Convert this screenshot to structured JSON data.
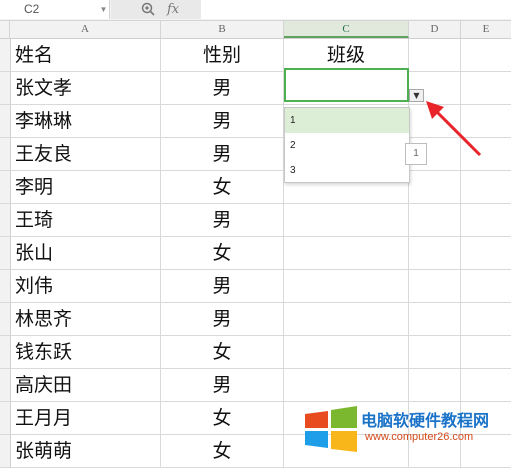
{
  "formula_bar": {
    "name_box": "C2",
    "fx_label": "fx",
    "formula_value": ""
  },
  "columns": [
    "A",
    "B",
    "C",
    "D",
    "E"
  ],
  "selected_column": "C",
  "headers": {
    "a": "姓名",
    "b": "性别",
    "c": "班级"
  },
  "rows": [
    {
      "name": "张文孝",
      "gender": "男"
    },
    {
      "name": "李琳琳",
      "gender": "男"
    },
    {
      "name": "王友良",
      "gender": "男"
    },
    {
      "name": "李明",
      "gender": "女"
    },
    {
      "name": "王琦",
      "gender": "男"
    },
    {
      "name": "张山",
      "gender": "女"
    },
    {
      "name": "刘伟",
      "gender": "男"
    },
    {
      "name": "林思齐",
      "gender": "男"
    },
    {
      "name": "钱东跃",
      "gender": "女"
    },
    {
      "name": "高庆田",
      "gender": "男"
    },
    {
      "name": "王月月",
      "gender": "女"
    },
    {
      "name": "张萌萌",
      "gender": "女"
    }
  ],
  "dropdown": {
    "options": [
      "1",
      "2",
      "3"
    ],
    "selected_index": 0,
    "tooltip": "1"
  },
  "watermark": {
    "title": "电脑软硬件教程网",
    "url": "www.computer26.com"
  },
  "colors": {
    "active_border": "#4caf50",
    "arrow": "#e8232a",
    "watermark_blue": "#1a73c8",
    "watermark_url": "#d24a1a"
  },
  "icons": {
    "zoom": "magnifier-icon",
    "fx": "function-icon",
    "dropdown": "chevron-down-icon",
    "arrow": "red-pointer-arrow-icon"
  }
}
